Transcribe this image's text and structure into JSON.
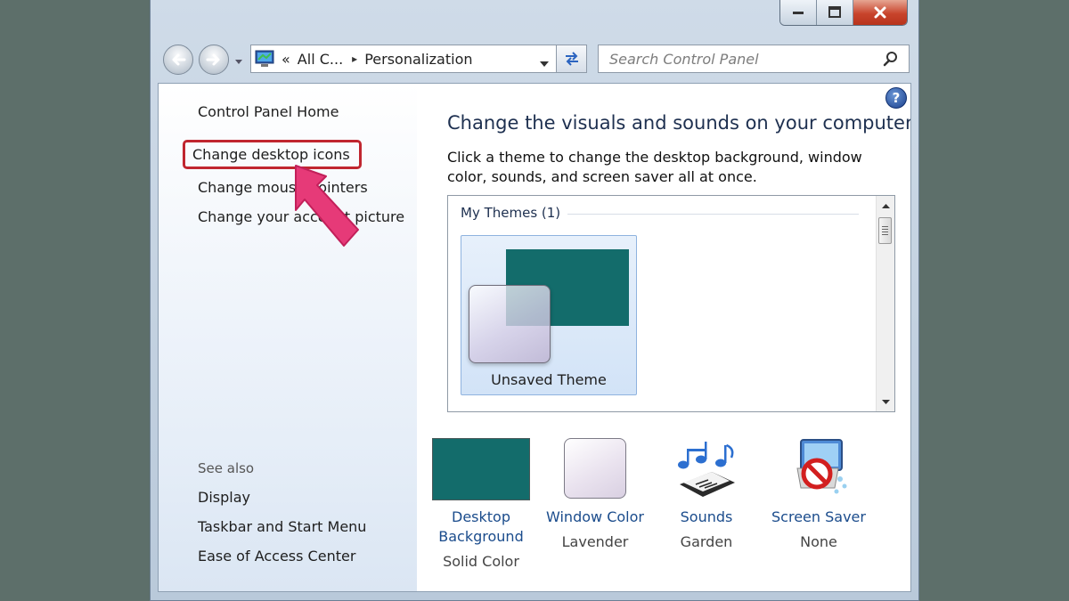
{
  "window": {
    "controls": {
      "minimize": "minimize",
      "maximize": "maximize",
      "close": "close"
    }
  },
  "address": {
    "prefix": "«",
    "crumb1": "All C...",
    "separator": "▸",
    "crumb2": "Personalization"
  },
  "search": {
    "placeholder": "Search Control Panel"
  },
  "sidebar": {
    "home": "Control Panel Home",
    "links": [
      "Change desktop icons",
      "Change mouse pointers",
      "Change your account picture"
    ],
    "see_also_title": "See also",
    "see_also": [
      "Display",
      "Taskbar and Start Menu",
      "Ease of Access Center"
    ]
  },
  "main": {
    "help": "?",
    "title": "Change the visuals and sounds on your computer",
    "description": "Click a theme to change the desktop background, window color, sounds, and screen saver all at once.",
    "themes": {
      "group_label": "My Themes (1)",
      "items": [
        {
          "name": "Unsaved Theme"
        }
      ]
    },
    "settings": [
      {
        "title": "Desktop Background",
        "value": "Solid Color"
      },
      {
        "title": "Window Color",
        "value": "Lavender"
      },
      {
        "title": "Sounds",
        "value": "Garden"
      },
      {
        "title": "Screen Saver",
        "value": "None"
      }
    ]
  },
  "colors": {
    "background_teal": "#136c6b",
    "highlight_red": "#c0262f",
    "annotation_arrow": "#e63a78",
    "link_blue": "#1b4c8c"
  },
  "icons": [
    "back-arrow-icon",
    "forward-arrow-icon",
    "control-panel-icon",
    "refresh-icon",
    "search-icon",
    "help-icon",
    "sounds-notes-icon",
    "screen-saver-icon"
  ]
}
